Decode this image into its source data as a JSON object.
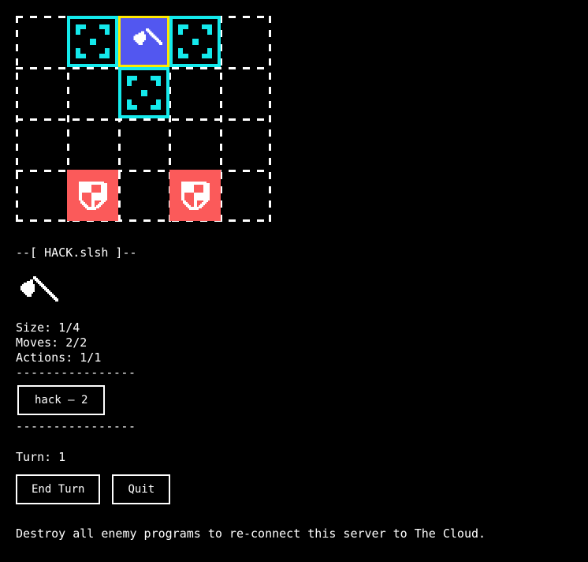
{
  "board": {
    "columns": 5,
    "rows": 4,
    "cell_size": 65,
    "colors": {
      "grid": "#ffffff",
      "selected_fill": "#5257f0",
      "selected_border": "#ffe800",
      "highlight": "#14e9ec",
      "enemy": "#fb5a5a",
      "background": "#000000"
    },
    "tiles": [
      {
        "name": "tile-move-target-left",
        "col": 1,
        "row": 0,
        "kind": "highlight",
        "icon": "move-target-icon"
      },
      {
        "name": "tile-player-unit",
        "col": 2,
        "row": 0,
        "kind": "selected",
        "icon": "axe-icon"
      },
      {
        "name": "tile-move-target-right",
        "col": 3,
        "row": 0,
        "kind": "highlight",
        "icon": "move-target-icon"
      },
      {
        "name": "tile-move-target-down",
        "col": 2,
        "row": 1,
        "kind": "highlight",
        "icon": "move-target-icon"
      },
      {
        "name": "tile-enemy-left",
        "col": 1,
        "row": 3,
        "kind": "enemy",
        "icon": "shield-icon"
      },
      {
        "name": "tile-enemy-right",
        "col": 3,
        "row": 3,
        "kind": "enemy",
        "icon": "shield-icon"
      }
    ]
  },
  "panel": {
    "title": "--[ HACK.slsh ]--",
    "portrait_icon": "axe-icon",
    "stats": [
      "Size: 1/4",
      "Moves: 2/2",
      "Actions: 1/1"
    ],
    "separator_top": "----------------",
    "separator_bottom": "----------------",
    "actions": [
      {
        "name": "hack-action-button",
        "label": "hack — 2"
      }
    ],
    "turn_label": "Turn: 1",
    "turn_buttons": [
      {
        "name": "end-turn-button",
        "label": "End Turn"
      },
      {
        "name": "quit-button",
        "label": "Quit"
      }
    ],
    "hint": "Destroy all enemy programs to re-connect this server to The Cloud."
  }
}
